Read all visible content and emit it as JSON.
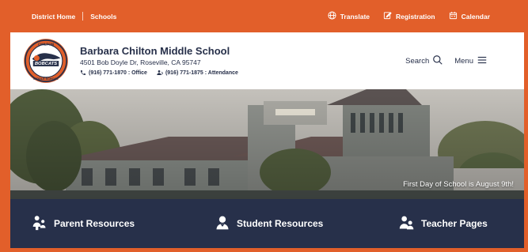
{
  "topbar": {
    "district_home": "District Home",
    "schools": "Schools",
    "translate": "Translate",
    "registration": "Registration",
    "calendar": "Calendar",
    "icons": [
      "globe-icon",
      "edit-icon",
      "calendar-icon"
    ]
  },
  "header": {
    "logo_text_top": "CHILTON",
    "logo_text_mid": "BOBCATS",
    "logo_text_bottom": "MIDDLE SCHOOL",
    "school_name": "Barbara Chilton Middle School",
    "address": "4501 Bob Doyle Dr, Roseville, CA 95747",
    "office_phone": "(916) 771-1870 : Office",
    "attendance_phone": "(916) 771-1875 : Attendance",
    "search_label": "Search",
    "menu_label": "Menu"
  },
  "hero": {
    "caption": "First Day of School is August 9th!"
  },
  "resources": {
    "parent": "Parent Resources",
    "student": "Student Resources",
    "teacher": "Teacher Pages"
  },
  "colors": {
    "accent": "#e25f2a",
    "navy": "#27304a"
  }
}
